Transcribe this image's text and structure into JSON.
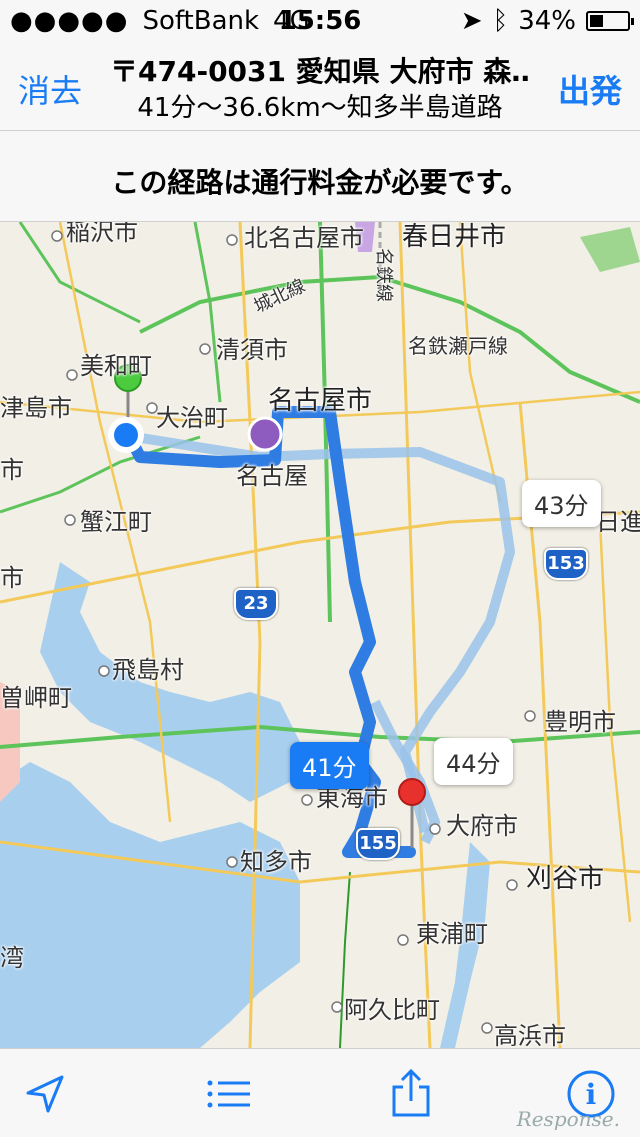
{
  "status": {
    "carrier": "SoftBank",
    "network": "4G",
    "time": "15:56",
    "battery": "34%"
  },
  "nav": {
    "left_button": "消去",
    "right_button": "出発",
    "title": "〒474-0031 愛知県 大府市 森…",
    "subtitle": "41分〜36.6km〜知多半島道路"
  },
  "notice": "この経路は通行料金が必要です。",
  "map": {
    "labels": [
      "稲沢市",
      "北名古屋市",
      "春日井市",
      "美和町",
      "清須市",
      "名鉄瀬戸線",
      "名古屋市",
      "津島市",
      "大治町",
      "名古屋",
      "市",
      "蟹江町",
      "日進",
      "市",
      "飛島村",
      "曽岬町",
      "豊明市",
      "東海市",
      "大府市",
      "知多市",
      "刈谷市",
      "東浦町",
      "阿久比町",
      "高浜市",
      "湾",
      "城北線",
      "名鉄線"
    ],
    "route_times": {
      "main": "41分",
      "alt1": "43分",
      "alt2": "44分"
    },
    "shields": [
      "153",
      "23",
      "155"
    ]
  },
  "toolbar": {
    "location": "location-arrow-icon",
    "list": "list-icon",
    "share": "share-icon",
    "info": "info-icon"
  },
  "watermark": "Response."
}
